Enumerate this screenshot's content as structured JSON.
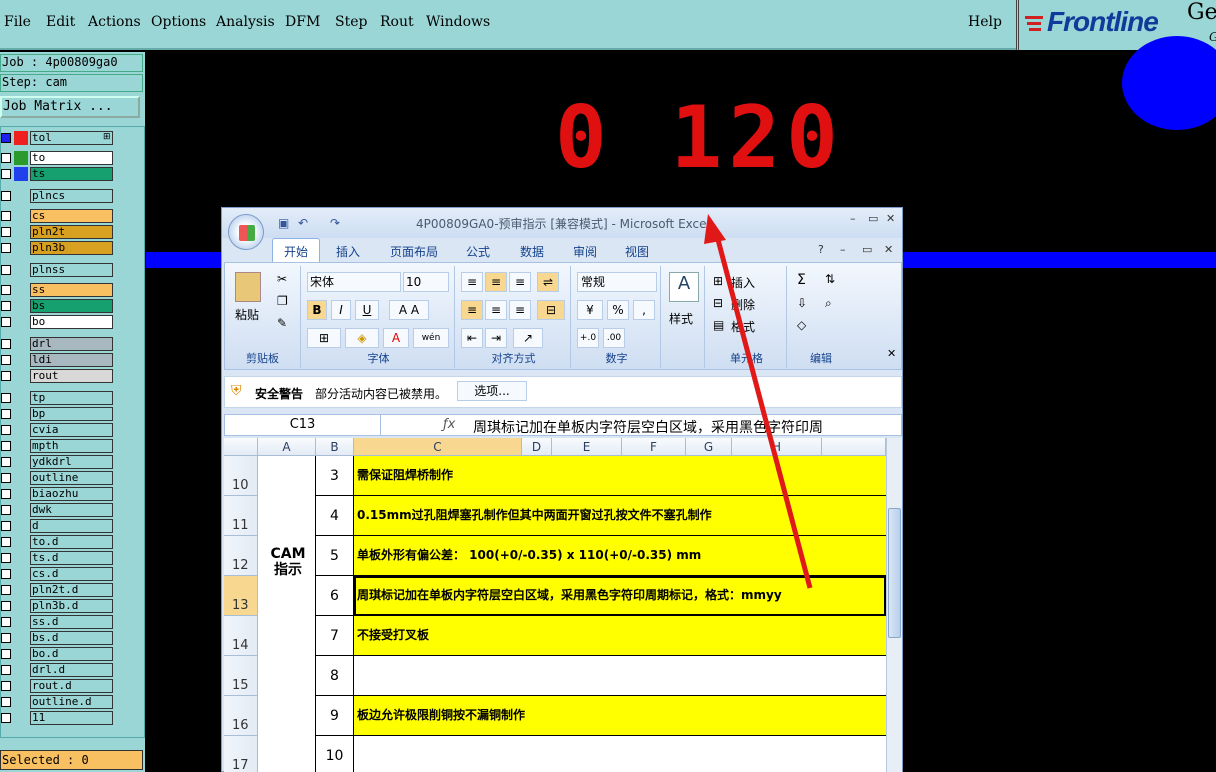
{
  "menubar": {
    "items": [
      "File",
      "Edit",
      "Actions",
      "Options",
      "Analysis",
      "DFM",
      "Step",
      "Rout",
      "Windows"
    ],
    "help": "Help",
    "logo": "Frontline",
    "logo_suffix": "Ge",
    "logo_suffix2": "G"
  },
  "panel": {
    "job": "Job : 4p00809ga0",
    "step": "Step: cam",
    "job_matrix": "Job Matrix ...",
    "selected": "Selected : 0",
    "layers": [
      {
        "name": "tol",
        "color": "#ee2020",
        "bg": "#9ad6d6",
        "mark": "⊞"
      },
      {
        "name": "to",
        "color": "#2a9a2a",
        "bg": "#ffffff"
      },
      {
        "name": "ts",
        "color": "#2040ee",
        "bg": "#16a070"
      },
      {
        "name": "plncs",
        "color": "",
        "bg": "#9ad6d6"
      },
      {
        "name": "cs",
        "color": "",
        "bg": "#f8c060"
      },
      {
        "name": "pln2t",
        "color": "",
        "bg": "#d8a020"
      },
      {
        "name": "pln3b",
        "color": "",
        "bg": "#d8a020"
      },
      {
        "name": "plnss",
        "color": "",
        "bg": "#9ad6d6"
      },
      {
        "name": "ss",
        "color": "",
        "bg": "#f8c060"
      },
      {
        "name": "bs",
        "color": "",
        "bg": "#16a070"
      },
      {
        "name": "bo",
        "color": "",
        "bg": "#ffffff"
      },
      {
        "name": "drl",
        "color": "",
        "bg": "#a8b8c0"
      },
      {
        "name": "ldi",
        "color": "",
        "bg": "#a8b8c0"
      },
      {
        "name": "rout",
        "color": "",
        "bg": "#d8d8d8"
      },
      {
        "name": "tp",
        "color": "",
        "bg": "#9ad6d6"
      },
      {
        "name": "bp",
        "color": "",
        "bg": "#9ad6d6"
      },
      {
        "name": "cvia",
        "color": "",
        "bg": "#9ad6d6"
      },
      {
        "name": "mpth",
        "color": "",
        "bg": "#9ad6d6"
      },
      {
        "name": "ydkdrl",
        "color": "",
        "bg": "#9ad6d6"
      },
      {
        "name": "outline",
        "color": "",
        "bg": "#9ad6d6"
      },
      {
        "name": "biaozhu",
        "color": "",
        "bg": "#9ad6d6"
      },
      {
        "name": "dwk",
        "color": "",
        "bg": "#9ad6d6"
      },
      {
        "name": "d",
        "color": "",
        "bg": "#9ad6d6"
      },
      {
        "name": "to.d",
        "color": "",
        "bg": "#9ad6d6"
      },
      {
        "name": "ts.d",
        "color": "",
        "bg": "#9ad6d6"
      },
      {
        "name": "cs.d",
        "color": "",
        "bg": "#9ad6d6"
      },
      {
        "name": "pln2t.d",
        "color": "",
        "bg": "#9ad6d6"
      },
      {
        "name": "pln3b.d",
        "color": "",
        "bg": "#9ad6d6"
      },
      {
        "name": "ss.d",
        "color": "",
        "bg": "#9ad6d6"
      },
      {
        "name": "bs.d",
        "color": "",
        "bg": "#9ad6d6"
      },
      {
        "name": "bo.d",
        "color": "",
        "bg": "#9ad6d6"
      },
      {
        "name": "drl.d",
        "color": "",
        "bg": "#9ad6d6"
      },
      {
        "name": "rout.d",
        "color": "",
        "bg": "#9ad6d6"
      },
      {
        "name": "outline.d",
        "color": "",
        "bg": "#9ad6d6"
      },
      {
        "name": "11",
        "color": "",
        "bg": "#9ad6d6"
      }
    ]
  },
  "canvas": {
    "counter": "0 120"
  },
  "excel": {
    "title": "4P00809GA0-预审指示  [兼容模式] - Microsoft Excel",
    "tabs": [
      "开始",
      "插入",
      "页面布局",
      "公式",
      "数据",
      "审阅",
      "视图"
    ],
    "ribbon": {
      "paste": "粘贴",
      "clipboard": "剪贴板",
      "font_name": "宋体",
      "font_size": "10",
      "font": "字体",
      "alignment": "对齐方式",
      "number_format": "常规",
      "number": "数字",
      "styles": "样式",
      "insert": "插入",
      "delete": "删除",
      "format": "格式",
      "cells": "单元格",
      "editing": "编辑",
      "bold": "B",
      "italic": "I",
      "underline": "U",
      "percent": "%",
      "comma": ","
    },
    "warning": {
      "title": "安全警告",
      "text": "部分活动内容已被禁用。",
      "button": "选项..."
    },
    "namebox": "C13",
    "formula": "周琪标记加在单板内字符层空白区域，采用黑色字符印周",
    "columns": [
      "A",
      "B",
      "C",
      "D",
      "E",
      "F",
      "G",
      "H"
    ],
    "a_cell": "CAM 指示",
    "rows": [
      {
        "row": "10",
        "num": "3",
        "text": "需保证阻焊桥制作",
        "fill": "#ffff00"
      },
      {
        "row": "11",
        "num": "4",
        "text": "0.15mm过孔阻焊塞孔制作但其中两面开窗过孔按文件不塞孔制作",
        "fill": "#ffff00"
      },
      {
        "row": "12",
        "num": "5",
        "text": "  单板外形有偏公差： 100(+0/-0.35) x 110(+0/-0.35) mm",
        "fill": "#ffff00"
      },
      {
        "row": "13",
        "num": "6",
        "text": "周琪标记加在单板内字符层空白区域，采用黑色字符印周期标记，格式：mmyy",
        "fill": "#ffff00"
      },
      {
        "row": "14",
        "num": "7",
        "text": "不接受打叉板",
        "fill": "#ffff00"
      },
      {
        "row": "15",
        "num": "8",
        "text": "",
        "fill": "#ffffff"
      },
      {
        "row": "16",
        "num": "9",
        "text": "板边允许极限削铜按不漏铜制作",
        "fill": "#ffff00"
      },
      {
        "row": "17",
        "num": "10",
        "text": "",
        "fill": "#ffffff"
      }
    ]
  }
}
